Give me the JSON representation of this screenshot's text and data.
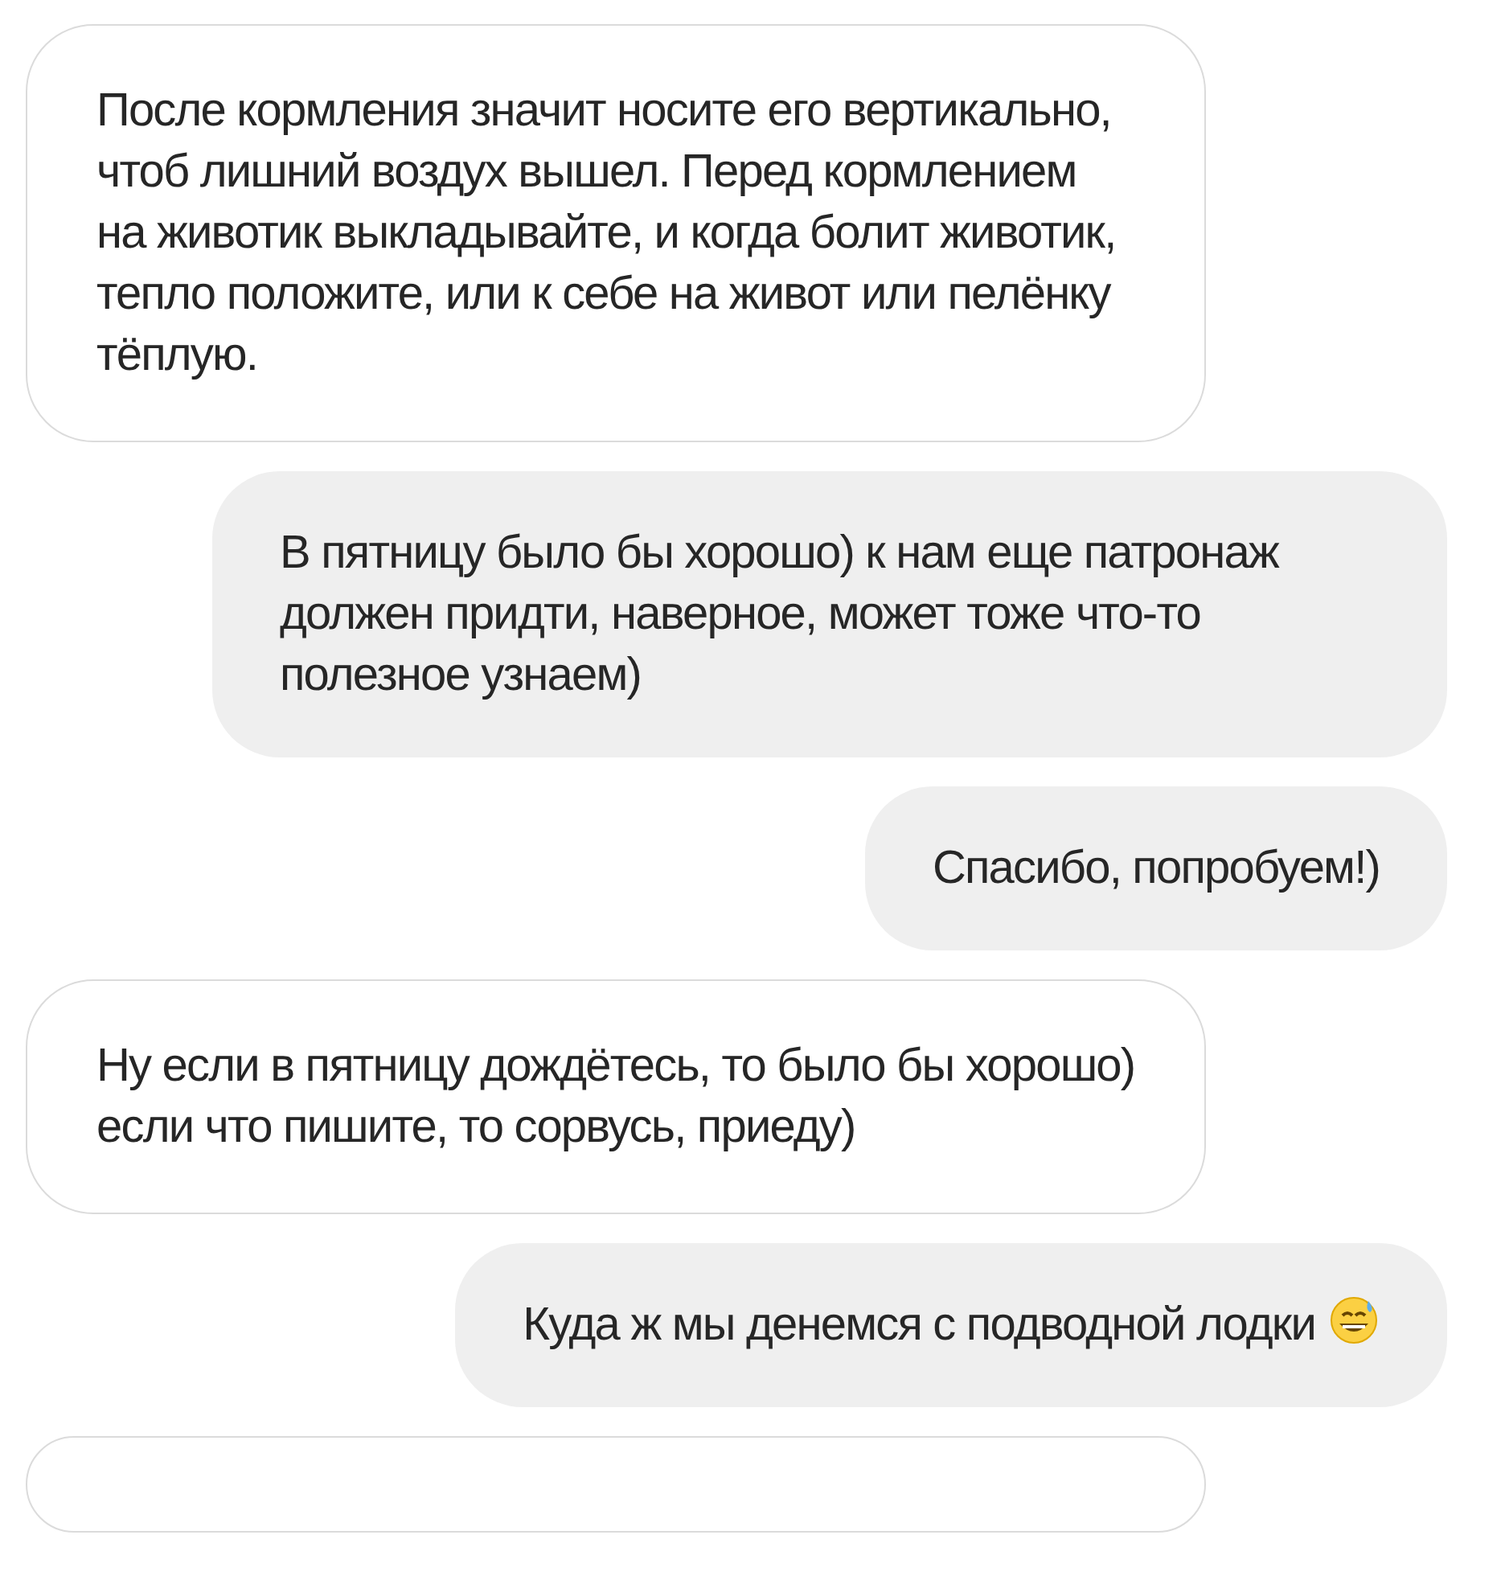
{
  "messages": [
    {
      "kind": "received",
      "text": "После кормления значит носите его вертикально, чтоб лишний воздух вышел. Перед кормлением на животик выкладывайте, и когда болит животик, тепло положите, или к себе на живот или пелёнку тёплую.",
      "emoji": false
    },
    {
      "kind": "sent",
      "text": "В пятницу было бы хорошо) к нам еще патронаж должен придти, наверное, может тоже что-то полезное узнаем)",
      "emoji": false
    },
    {
      "kind": "sent",
      "text": "Спасибо, попробуем!)",
      "emoji": false
    },
    {
      "kind": "received",
      "text": "Ну если в пятницу дождётесь, то было бы хорошо) если что пишите, то сорвусь, приеду)",
      "emoji": false
    },
    {
      "kind": "sent",
      "text": "Куда ж мы денемся с подводной лодки",
      "emoji": true
    }
  ]
}
